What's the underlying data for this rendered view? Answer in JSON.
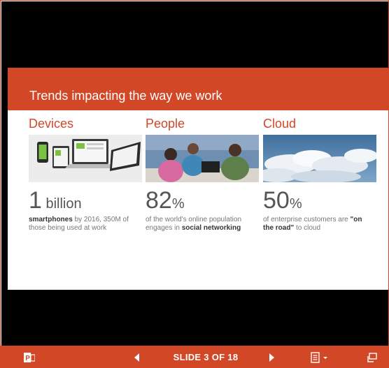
{
  "slide": {
    "title": "Trends impacting the way we work",
    "columns": [
      {
        "heading": "Devices",
        "stat_big": "1",
        "stat_unit": " billion",
        "desc_bold_1": "smartphones",
        "desc_text_1": " by 2016, 350M of those being used at work",
        "desc_text_2": "",
        "desc_bold_2": ""
      },
      {
        "heading": "People",
        "stat_big": "82",
        "stat_unit": "%",
        "desc_text_1": "of the world's online population engages in ",
        "desc_bold_2": "social networking"
      },
      {
        "heading": "Cloud",
        "stat_big": "50",
        "stat_unit": "%",
        "desc_text_1": "of enterprise customers are ",
        "desc_bold_2": "\"on the road\"",
        "desc_text_2": " to cloud"
      }
    ]
  },
  "toolbar": {
    "app_icon": "powerpoint-icon",
    "prev_icon": "previous-slide-icon",
    "slide_counter": "SLIDE 3 OF 18",
    "next_icon": "next-slide-icon",
    "notes_icon": "notes-menu-icon",
    "popout_icon": "pop-out-icon"
  },
  "colors": {
    "accent": "#d24726",
    "stage": "#000000",
    "slide_bg": "#ffffff"
  }
}
